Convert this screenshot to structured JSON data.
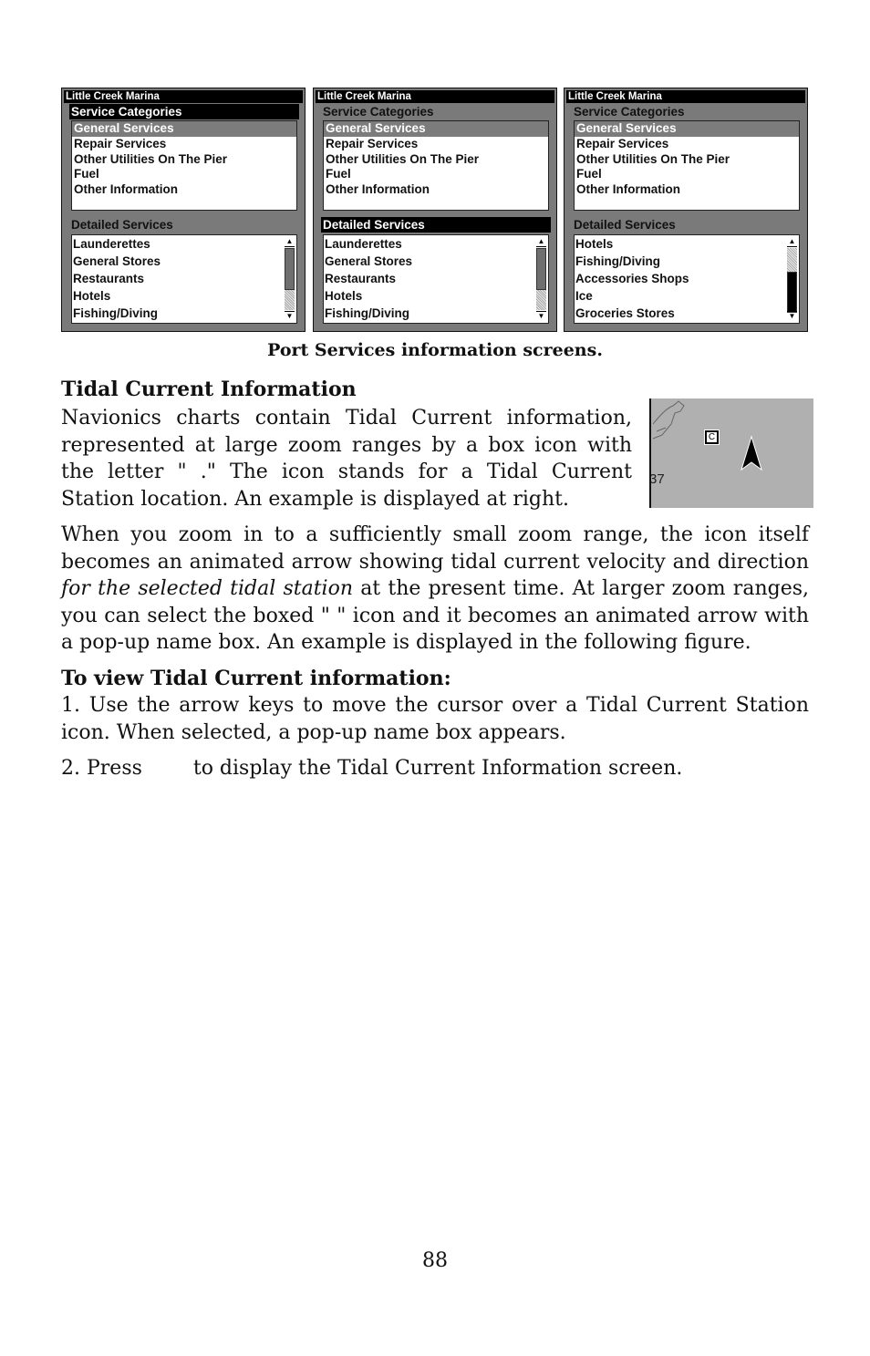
{
  "figure": {
    "screens": [
      {
        "title": "Little Creek Marina",
        "section1_label": "Service Categories",
        "section1_active": true,
        "categories": [
          "General Services",
          "Repair Services",
          "Other Utilities On The Pier",
          "Fuel",
          "Other Information"
        ],
        "selected_category": "General Services",
        "section2_label": "Detailed Services",
        "section2_active": false,
        "details": [
          "Launderettes",
          "General Stores",
          "Restaurants",
          "Hotels",
          "Fishing/Diving"
        ],
        "scroll_position": 0.0
      },
      {
        "title": "Little Creek Marina",
        "section1_label": "Service Categories",
        "section1_active": false,
        "categories": [
          "General Services",
          "Repair Services",
          "Other Utilities On The Pier",
          "Fuel",
          "Other Information"
        ],
        "selected_category": "General Services",
        "section2_label": "Detailed Services",
        "section2_active": true,
        "details": [
          "Launderettes",
          "General Stores",
          "Restaurants",
          "Hotels",
          "Fishing/Diving"
        ],
        "scroll_position": 0.0
      },
      {
        "title": "Little Creek Marina",
        "section1_label": "Service Categories",
        "section1_active": false,
        "categories": [
          "General Services",
          "Repair Services",
          "Other Utilities On The Pier",
          "Fuel",
          "Other Information"
        ],
        "selected_category": "General Services",
        "section2_label": "Detailed Services",
        "section2_active": false,
        "details": [
          "Hotels",
          "Fishing/Diving",
          "Accessories Shops",
          "Ice",
          "Groceries Stores"
        ],
        "scroll_position": 1.0
      }
    ],
    "caption": "Port Services information screens."
  },
  "section": {
    "heading": "Tidal Current Information",
    "para1": "Navionics charts contain Tidal Current information, represented at large zoom ranges by a box icon with the letter \"  .\" The icon stands for a Tidal Current Station location. An example is displayed at right.",
    "map_inset": {
      "station_letter": "C",
      "depth_label": "37"
    },
    "para2_a": "When you zoom in to a sufficiently small zoom range, the icon itself becomes an animated arrow showing tidal current velocity and direction ",
    "para2_italic": "for the selected tidal station",
    "para2_b": " at the present time. At larger zoom ranges, you can select the boxed \"  \" icon and it becomes an animated arrow with a pop-up name box. An example is displayed in the following figure.",
    "subheading": "To view Tidal Current information:",
    "step1": "1. Use the arrow keys to move the cursor over a Tidal Current Station icon. When selected, a pop-up name box appears.",
    "step2": "2. Press        to display the Tidal Current Information screen."
  },
  "page_number": "88"
}
